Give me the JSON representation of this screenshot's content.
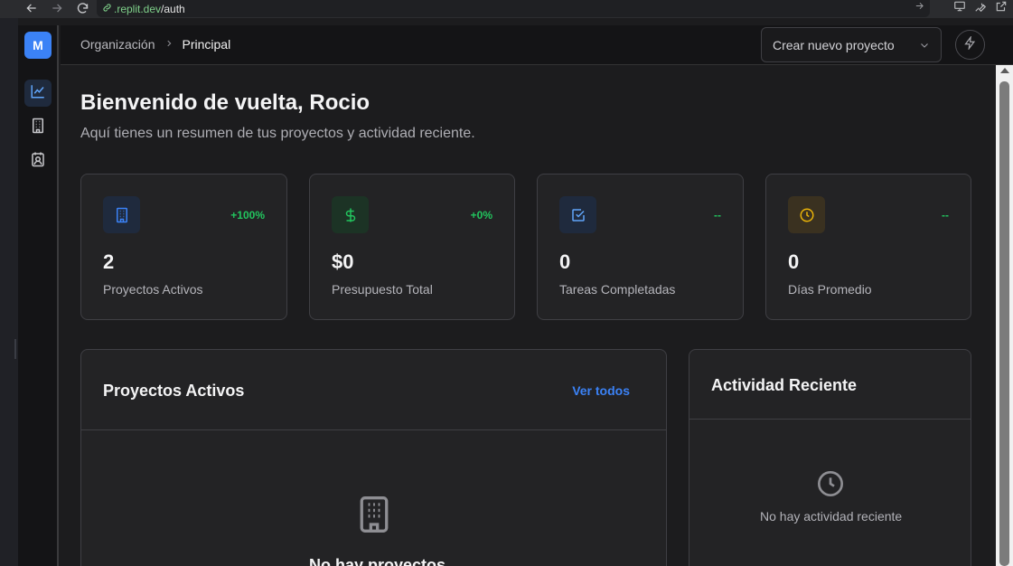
{
  "browser": {
    "url_host": ".replit.dev",
    "url_path": "/auth"
  },
  "sidebar": {
    "logo_letter": "M",
    "items": [
      {
        "icon": "chart-line-icon",
        "active": true
      },
      {
        "icon": "building-icon",
        "active": false
      },
      {
        "icon": "contact-badge-icon",
        "active": false
      }
    ]
  },
  "header": {
    "breadcrumb": [
      "Organización",
      "Principal"
    ],
    "project_select": "Crear nuevo proyecto",
    "action_icon": "bolt-icon"
  },
  "main": {
    "title": "Bienvenido de vuelta, Rocio",
    "subtitle": "Aquí tienes un resumen de tus proyectos y actividad reciente.",
    "stats": [
      {
        "value": "2",
        "label": "Proyectos Activos",
        "delta": "+100%",
        "icon": "building-icon",
        "color": "#3b82f6"
      },
      {
        "value": "$0",
        "label": "Presupuesto Total",
        "delta": "+0%",
        "icon": "dollar-icon",
        "color": "#22c55e"
      },
      {
        "value": "0",
        "label": "Tareas Completadas",
        "delta": "--",
        "icon": "check-square-icon",
        "color": "#3b82f6"
      },
      {
        "value": "0",
        "label": "Días Promedio",
        "delta": "--",
        "icon": "clock-icon",
        "color": "#eab308"
      }
    ],
    "projects_panel": {
      "title": "Proyectos Activos",
      "view_all": "Ver todos",
      "empty_title": "No hay proyectos"
    },
    "activity_panel": {
      "title": "Actividad Reciente",
      "empty_text": "No hay actividad reciente"
    }
  }
}
